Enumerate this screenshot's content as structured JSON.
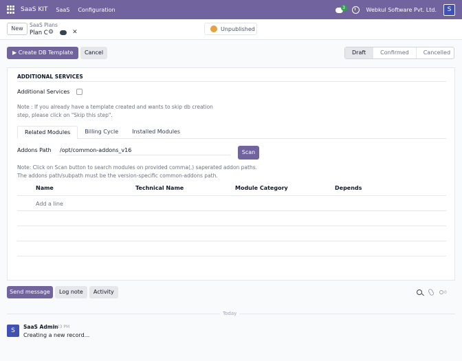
{
  "topbar": {
    "app_name": "SaaS KIT",
    "menu": [
      "SaaS",
      "Configuration"
    ],
    "chat_badge": "3",
    "company": "Webkul Software Pvt. Ltd.",
    "avatar_letter": "S"
  },
  "control": {
    "new_label": "New",
    "breadcrumb_parent": "SaaS Plans",
    "breadcrumb_current": "Plan C",
    "publish_status": "Unpublished"
  },
  "actions": {
    "primary_label": "Create DB Template",
    "cancel_label": "Cancel",
    "stages": [
      "Draft",
      "Confirmed",
      "Cancelled"
    ],
    "active_stage": "Draft"
  },
  "form": {
    "section_title": "ADDITIONAL SERVICES",
    "additional_services_label": "Additional Services",
    "additional_services_checked": false,
    "note1": "Note : If you already have a template created and wants to skip db creation step, please click on \"Skip this step\".",
    "tabs": [
      "Related Modules",
      "Billing Cycle",
      "Installed Modules"
    ],
    "addons_path_label": "Addons Path",
    "addons_path_value": "/opt/common-addons_v16",
    "scan_label": "Scan",
    "note2_line1": "Note: Click on Scan button to search modules on provided comma(,) saperated addon paths.",
    "note2_line2": "The addons path/subpath must be the version-specific common-addons path.",
    "table": {
      "columns": [
        "Name",
        "Technical Name",
        "Module Category",
        "Depends"
      ],
      "add_line": "Add a line"
    }
  },
  "chatter": {
    "send_message": "Send message",
    "log_note": "Log note",
    "activity": "Activity",
    "follower_count": "0",
    "today": "Today",
    "message": {
      "avatar_letter": "S",
      "author": "SaaS Admin",
      "time": "1:23 PM",
      "body": "Creating a new record..."
    }
  }
}
